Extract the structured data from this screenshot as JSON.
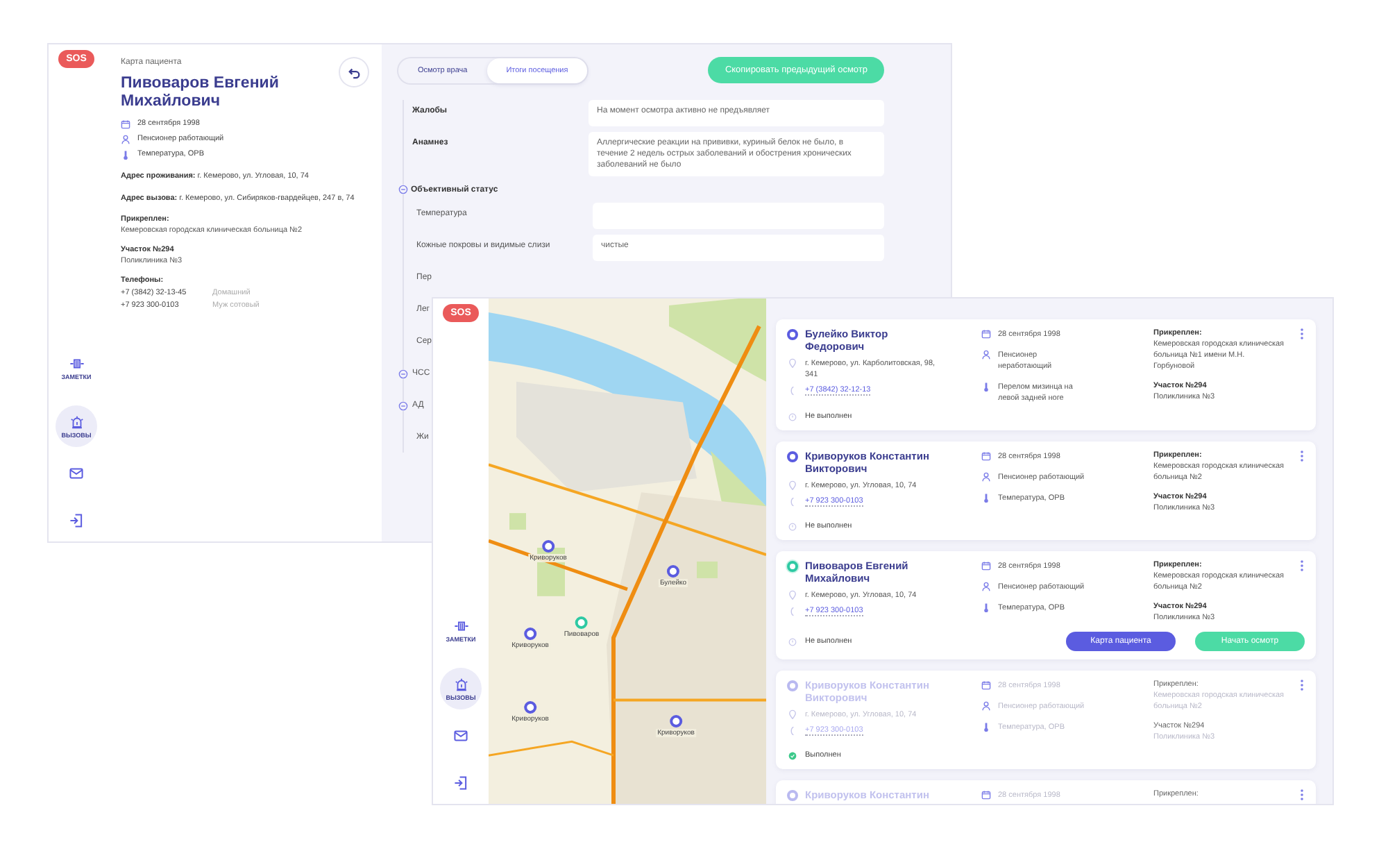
{
  "back_window": {
    "sidebar": {
      "sos": "SOS",
      "nav": [
        {
          "kind": "notes",
          "label": "ЗАМЕТКИ",
          "selected": false
        },
        {
          "kind": "calls",
          "label": "ВЫЗОВЫ",
          "selected": true
        }
      ]
    },
    "patient": {
      "caption": "Карта пациента",
      "name": "Пивоваров Евгений Михайлович",
      "facts": [
        {
          "kind": "date",
          "text": "28 сентября 1998"
        },
        {
          "kind": "person",
          "text": "Пенсионер работающий"
        },
        {
          "kind": "diagnosis",
          "text": "Температура, ОРВ"
        }
      ],
      "addresses": [
        {
          "label": "Адрес проживания:",
          "value": "г. Кемерово, ул. Угловая, 10, 74"
        },
        {
          "label": "Адрес вызова:",
          "value": "г. Кемерово, ул. Сибиряков-гвардейцев, 247 в, 74"
        }
      ],
      "attached": {
        "label": "Прикреплен:",
        "value": "Кемеровская городская клиническая больница №2"
      },
      "district": {
        "label": "Участок №294",
        "value": "Поликлиника №3"
      },
      "phones": {
        "label": "Телефоны:",
        "items": [
          {
            "number": "+7 (3842) 32-13-45",
            "note": "Домашний"
          },
          {
            "number": "+7 923 300-0103",
            "note": "Муж сотовый"
          }
        ]
      }
    },
    "exam": {
      "tabs": [
        {
          "label": "Осмотр врача",
          "selected": false
        },
        {
          "label": "Итоги посещения",
          "selected": true
        }
      ],
      "copy_button": "Скопировать предыдущий осмотр",
      "fields": [
        {
          "label": "Жалобы",
          "value": "На момент осмотра активно не предъявляет"
        },
        {
          "label": "Анамнез",
          "value": "Аллергические реакции на прививки, куриный белок не было, в течение 2 недель острых заболеваний и обострения хронических заболеваний не было"
        }
      ],
      "section": {
        "label": "Объективный статус",
        "expanded": true
      },
      "rows": [
        {
          "kind": "field",
          "label": "Температура"
        },
        {
          "kind": "field",
          "label": "Кожные покровы и видимые слизи",
          "value": "чистые"
        },
        {
          "kind": "plain",
          "label": "Пер"
        },
        {
          "kind": "plain",
          "label": "Лег"
        },
        {
          "kind": "plain",
          "label": "Сер"
        },
        {
          "kind": "group",
          "label": "ЧСС"
        },
        {
          "kind": "group",
          "label": "АД"
        },
        {
          "kind": "plain",
          "label": "Жи"
        }
      ]
    }
  },
  "front_window": {
    "sidebar": {
      "sos": "SOS",
      "nav": [
        {
          "kind": "notes",
          "label": "ЗАМЕТКИ",
          "selected": false
        },
        {
          "kind": "calls",
          "label": "ВЫЗОВЫ",
          "selected": true
        }
      ]
    },
    "map_markers": [
      {
        "label": "Криворуков",
        "selected": false
      },
      {
        "label": "Булейко",
        "selected": false
      },
      {
        "label": "Пивоваров",
        "selected": true
      },
      {
        "label": "Криворуков",
        "selected": false
      },
      {
        "label": "Криворуков",
        "selected": false
      },
      {
        "label": "Криворуков",
        "selected": false
      }
    ],
    "cards": [
      {
        "name": "Булейко Виктор Федорович",
        "selected": false,
        "done": false,
        "address": "г. Кемерово, ул. Карболитовская, 98, 341",
        "phone": "+7 (3842) 32-12-13",
        "state": "Не выполнен",
        "date": "28 сентября 1998",
        "status": "Пенсионер неработающий",
        "diagnosis": "Перелом мизинца на левой задней ноге",
        "attached_label": "Прикреплен:",
        "attached": "Кемеровская городская клиническая больница №1 имени М.Н. Горбуновой",
        "district": "Участок №294",
        "clinic": "Поликлиника №3"
      },
      {
        "name": "Криворуков Константин Викторович",
        "selected": false,
        "done": false,
        "address": "г. Кемерово, ул. Угловая, 10, 74",
        "phone": "+7 923 300-0103",
        "state": "Не выполнен",
        "date": "28 сентября 1998",
        "status": "Пенсионер работающий",
        "diagnosis": "Температура, ОРВ",
        "attached_label": "Прикреплен:",
        "attached": "Кемеровская городская клиническая больница №2",
        "district": "Участок №294",
        "clinic": "Поликлиника №3"
      },
      {
        "name": "Пивоваров Евгений Михайлович",
        "selected": true,
        "done": false,
        "address": "г. Кемерово, ул. Угловая, 10, 74",
        "phone": "+7 923 300-0103",
        "state": "Не выполнен",
        "date": "28 сентября 1998",
        "status": "Пенсионер работающий",
        "diagnosis": "Температура, ОРВ",
        "attached_label": "Прикреплен:",
        "attached": "Кемеровская городская клиническая больница №2",
        "district": "Участок №294",
        "clinic": "Поликлиника №3",
        "actions": [
          {
            "kind": "primary",
            "label": "Карта пациента"
          },
          {
            "kind": "success",
            "label": "Начать осмотр"
          }
        ]
      },
      {
        "name": "Криворуков Константин Викторович",
        "selected": false,
        "done": true,
        "address": "г. Кемерово, ул. Угловая, 10, 74",
        "phone": "+7 923 300-0103",
        "state": "Выполнен",
        "date": "28 сентября 1998",
        "status": "Пенсионер работающий",
        "diagnosis": "Температура, ОРВ",
        "attached_label": "Прикреплен:",
        "attached": "Кемеровская городская клиническая больница №2",
        "district": "Участок №294",
        "clinic": "Поликлиника №3"
      },
      {
        "name": "Криворуков Константин",
        "selected": false,
        "done": true,
        "date": "28 сентября 1998",
        "attached_label": "Прикреплен:"
      }
    ]
  }
}
